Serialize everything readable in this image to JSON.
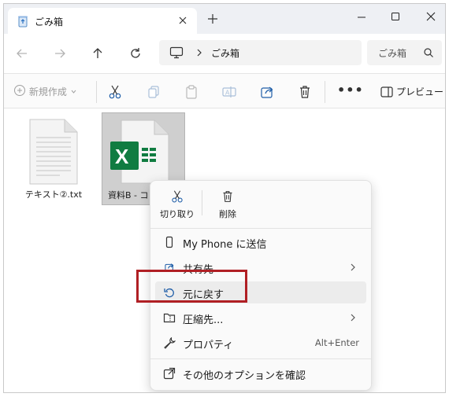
{
  "tab": {
    "title": "ごみ箱",
    "close": "×"
  },
  "new_tab": "+",
  "address": {
    "location": "ごみ箱"
  },
  "search": {
    "placeholder": "ごみ箱"
  },
  "toolbar": {
    "new_label": "新規作成",
    "more": "•••",
    "preview_label": "プレビュー"
  },
  "files": [
    {
      "name": "テキスト②.txt",
      "type": "text"
    },
    {
      "name": "資料B - コ",
      "type": "excel",
      "selected": true
    }
  ],
  "menu": {
    "cut_label": "切り取り",
    "delete_label": "削除",
    "items": [
      {
        "label": "My Phone に送信"
      },
      {
        "label": "共有先",
        "submenu": true
      },
      {
        "label": "元に戻す",
        "hover": true
      },
      {
        "label": "圧縮先...",
        "submenu": true
      },
      {
        "label": "プロパティ",
        "shortcut": "Alt+Enter"
      },
      {
        "label": "その他のオプションを確認"
      }
    ]
  },
  "colors": {
    "highlight_border": "#b01f24",
    "excel_green": "#107c41"
  }
}
